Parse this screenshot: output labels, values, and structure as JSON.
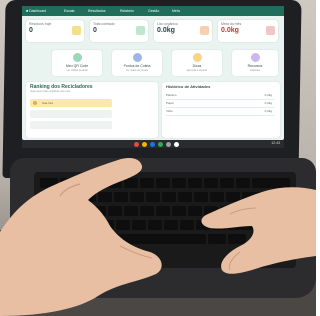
{
  "scene": {
    "subject": "",
    "colors": {
      "accent": "#1f6d5a",
      "screen_bg": "#e9f3ef",
      "skin": "#e9bfa4",
      "laptop": "#1e1f22"
    }
  },
  "app": {
    "tabs": [
      {
        "label": "■ Dashboard"
      },
      {
        "label": "Escala"
      },
      {
        "label": "Resultados"
      },
      {
        "label": "Relatório"
      },
      {
        "label": "Gestão"
      },
      {
        "label": "Meta"
      }
    ],
    "stats": [
      {
        "title": "Resíduos hoje",
        "value": "0",
        "icon": "leaf-icon",
        "color": "#f4e08a"
      },
      {
        "title": "Total coletado",
        "value": "0",
        "icon": "recycle-icon",
        "color": "#bfe6cf"
      },
      {
        "title": "Lixo orgânico",
        "value": "0.0kg",
        "icon": "scale-icon",
        "color": "#f7d0b4"
      },
      {
        "title": "Meta do mês",
        "value": "0.0kg",
        "icon": "target-icon",
        "color": "#f3c6c6"
      }
    ],
    "tiles": [
      {
        "label": "Meu QR Code",
        "sub": "ver código pessoal",
        "icon": "qr-code-icon",
        "color": "#9ad9b7"
      },
      {
        "label": "Pontos de Coleta",
        "sub": "ver mapa de pontos",
        "icon": "map-pin-icon",
        "color": "#9fb5e8"
      },
      {
        "label": "Dicas",
        "sub": "aprenda a separar",
        "icon": "lightbulb-icon",
        "color": "#f5d487"
      },
      {
        "label": "Recursos",
        "sub": "materiais",
        "icon": "book-icon",
        "color": "#cbb7ec"
      }
    ],
    "ranking": {
      "title": "Ranking dos Recicladores",
      "subtitle": "Veja quem mais contribuiu este mês",
      "rows": [
        {
          "label": "Sua Vez",
          "color": "#fbe9a9"
        },
        {
          "label": "",
          "color": "#eef3f1"
        },
        {
          "label": "",
          "color": "#eef3f1"
        }
      ]
    },
    "history": {
      "title": "Histórico de Atividades",
      "rows": [
        {
          "label": "Plástico",
          "value": "0,0kg"
        },
        {
          "label": "Papel",
          "value": "0,0kg"
        },
        {
          "label": "Vidro",
          "value": "0,0kg"
        }
      ]
    }
  },
  "shelf": {
    "time": "12:43",
    "dock_colors": [
      "#e34b3b",
      "#f4b400",
      "#1a73e8",
      "#34a853",
      "#9aa0a6",
      "#ffffff"
    ]
  }
}
